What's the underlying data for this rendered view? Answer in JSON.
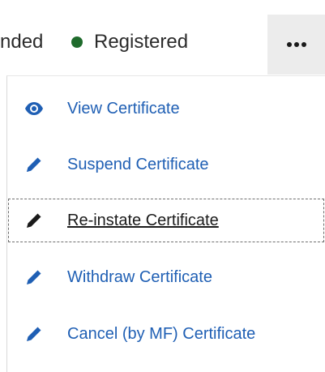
{
  "header": {
    "status_truncated": "nded",
    "status_registered": "Registered",
    "status_dot_color": "#1f6b2c",
    "more_button_icon": "more-horizontal-icon"
  },
  "menu": {
    "items": [
      {
        "label": "View Certificate",
        "icon": "eye-icon",
        "active": false
      },
      {
        "label": "Suspend Certificate",
        "icon": "pencil-icon",
        "active": false
      },
      {
        "label": "Re-instate Certificate",
        "icon": "pencil-icon",
        "active": true
      },
      {
        "label": "Withdraw Certificate",
        "icon": "pencil-icon",
        "active": false
      },
      {
        "label": "Cancel (by MF) Certificate",
        "icon": "pencil-icon",
        "active": false
      }
    ]
  },
  "colors": {
    "link": "#1f5fb4",
    "active_text": "#1a1a1a",
    "more_button_bg": "#ececec"
  }
}
